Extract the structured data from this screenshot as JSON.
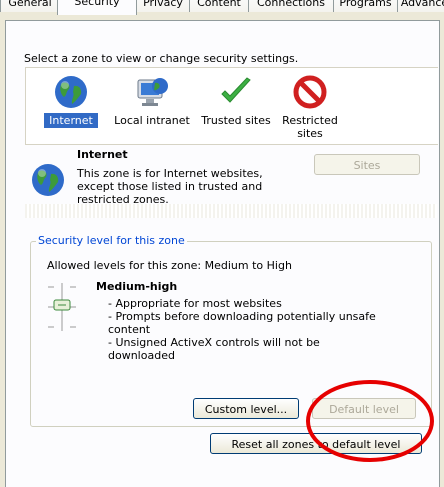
{
  "tabs": [
    {
      "label": "General"
    },
    {
      "label": "Security",
      "active": true
    },
    {
      "label": "Privacy"
    },
    {
      "label": "Content"
    },
    {
      "label": "Connections"
    },
    {
      "label": "Programs"
    },
    {
      "label": "Advanced"
    }
  ],
  "intro_text": "Select a zone to view or change security settings.",
  "zones": [
    {
      "label": "Internet",
      "icon": "globe-icon",
      "selected": true
    },
    {
      "label": "Local intranet",
      "icon": "intranet-computer-icon"
    },
    {
      "label": "Trusted sites",
      "icon": "checkmark-icon"
    },
    {
      "label": "Restricted sites",
      "icon": "restricted-icon"
    }
  ],
  "zone_info": {
    "title": "Internet",
    "description": "This zone is for Internet websites, except those listed in trusted and restricted zones.",
    "sites_button": "Sites"
  },
  "security_level": {
    "group_label": "Security level for this zone",
    "allowed_levels": "Allowed levels for this zone: Medium to High",
    "level_name": "Medium-high",
    "bullets": [
      "- Appropriate for most websites",
      "- Prompts before downloading potentially unsafe content",
      "- Unsigned ActiveX controls will not be downloaded"
    ],
    "custom_level_button": "Custom level...",
    "default_level_button": "Default level"
  },
  "reset_button": "Reset all zones to default level",
  "colors": {
    "accent": "#316ac5",
    "highlight_ellipse": "#e60000",
    "group_label": "#0046d5"
  }
}
